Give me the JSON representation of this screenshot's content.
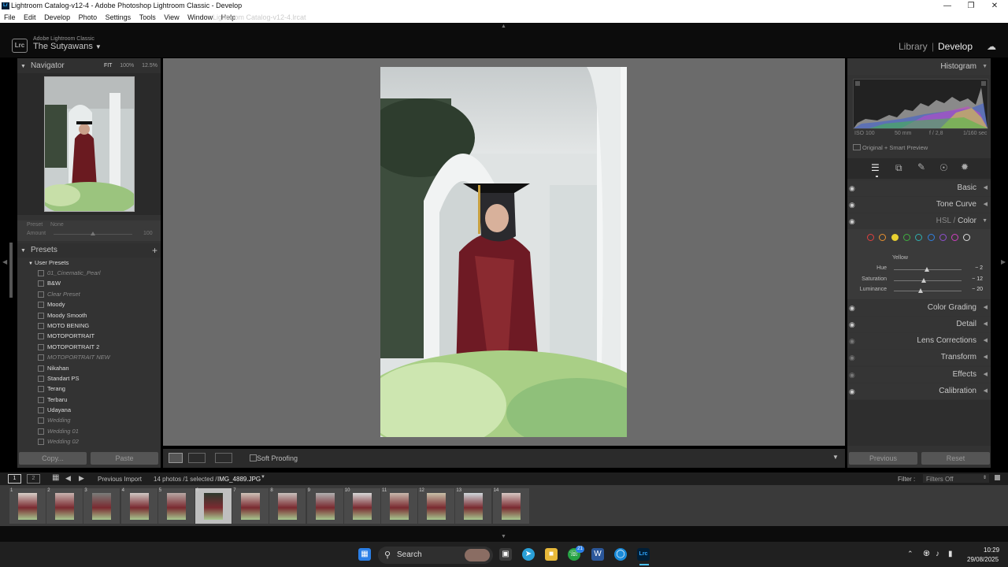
{
  "window": {
    "title": "Lightroom Catalog-v12-4 - Adobe Photoshop Lightroom Classic - Develop",
    "logo": "Lr",
    "ghost_path": "Lightroom Catalog-v12-4.lrcat"
  },
  "menu": [
    "File",
    "Edit",
    "Develop",
    "Photo",
    "Settings",
    "Tools",
    "View",
    "Window",
    "Help"
  ],
  "header": {
    "badge": "Lrc",
    "product": "Adobe Lightroom Classic",
    "catalog": "The Sutyawans",
    "modules": {
      "library": "Library",
      "sep": "|",
      "develop": "Develop"
    }
  },
  "navigator": {
    "title": "Navigator",
    "zoom_options": [
      "FIT",
      "100%",
      "12.5%"
    ]
  },
  "preset_amount": {
    "preset_label": "Preset",
    "preset_value": "None",
    "amount_label": "Amount",
    "amount_value": "100"
  },
  "presets": {
    "title": "Presets",
    "folder": "User Presets",
    "items": [
      {
        "label": "01_Cinematic_Pearl",
        "dim": true
      },
      {
        "label": "B&W",
        "dim": false
      },
      {
        "label": "Clear Preset",
        "dim": true
      },
      {
        "label": "Moody",
        "dim": false
      },
      {
        "label": "Moody Smooth",
        "dim": false
      },
      {
        "label": "MOTO BENING",
        "dim": false
      },
      {
        "label": "MOTOPORTRAIT",
        "dim": false
      },
      {
        "label": "MOTOPORTRAIT 2",
        "dim": false
      },
      {
        "label": "MOTOPORTRAIT NEW",
        "dim": true
      },
      {
        "label": "Nikahan",
        "dim": false
      },
      {
        "label": "Standart PS",
        "dim": false
      },
      {
        "label": "Terang",
        "dim": false
      },
      {
        "label": "Terbaru",
        "dim": false
      },
      {
        "label": "Udayana",
        "dim": false
      },
      {
        "label": "Wedding",
        "dim": true
      },
      {
        "label": "Wedding 01",
        "dim": true
      },
      {
        "label": "Wedding 02",
        "dim": true
      }
    ]
  },
  "left_buttons": {
    "copy": "Copy...",
    "paste": "Paste"
  },
  "toolbar": {
    "soft_proofing": "Soft Proofing"
  },
  "histogram": {
    "title": "Histogram",
    "iso": "ISO 100",
    "focal": "50 mm",
    "aperture": "f / 2,8",
    "shutter": "1/160 sec",
    "preview": "Original + Smart Preview"
  },
  "panels": {
    "basic": "Basic",
    "tone_curve": "Tone Curve",
    "hsl_prefix": "HSL",
    "hsl_sep": "/",
    "hsl_color": "Color",
    "color_grading": "Color Grading",
    "detail": "Detail",
    "lens": "Lens Corrections",
    "transform": "Transform",
    "effects": "Effects",
    "calibration": "Calibration"
  },
  "hsl": {
    "selected_color": "Yellow",
    "swatches": [
      "#e04040",
      "#e89030",
      "#e8d030",
      "#40b040",
      "#30b0b0",
      "#3080e0",
      "#9050d0",
      "#d040c0",
      "#dddddd"
    ],
    "sliders": [
      {
        "label": "Hue",
        "value": "− 2",
        "pos": 0.49
      },
      {
        "label": "Saturation",
        "value": "− 12",
        "pos": 0.44
      },
      {
        "label": "Luminance",
        "value": "− 20",
        "pos": 0.4
      }
    ]
  },
  "right_buttons": {
    "previous": "Previous",
    "reset": "Reset"
  },
  "filmstrip": {
    "views": [
      "1",
      "2"
    ],
    "source": "Previous Import",
    "count": "14 photos /1 selected /",
    "file": "IMG_4889.JPG",
    "filter_label": "Filter :",
    "filter_value": "Filters Off",
    "numbers": [
      "1",
      "2",
      "3",
      "4",
      "5",
      "6",
      "7",
      "8",
      "9",
      "10",
      "11",
      "12",
      "13",
      "14"
    ],
    "selected_index": 5
  },
  "taskbar": {
    "search": "Search",
    "time": "10:29",
    "date": "29/08/2025",
    "whatsapp_badge": "21"
  }
}
